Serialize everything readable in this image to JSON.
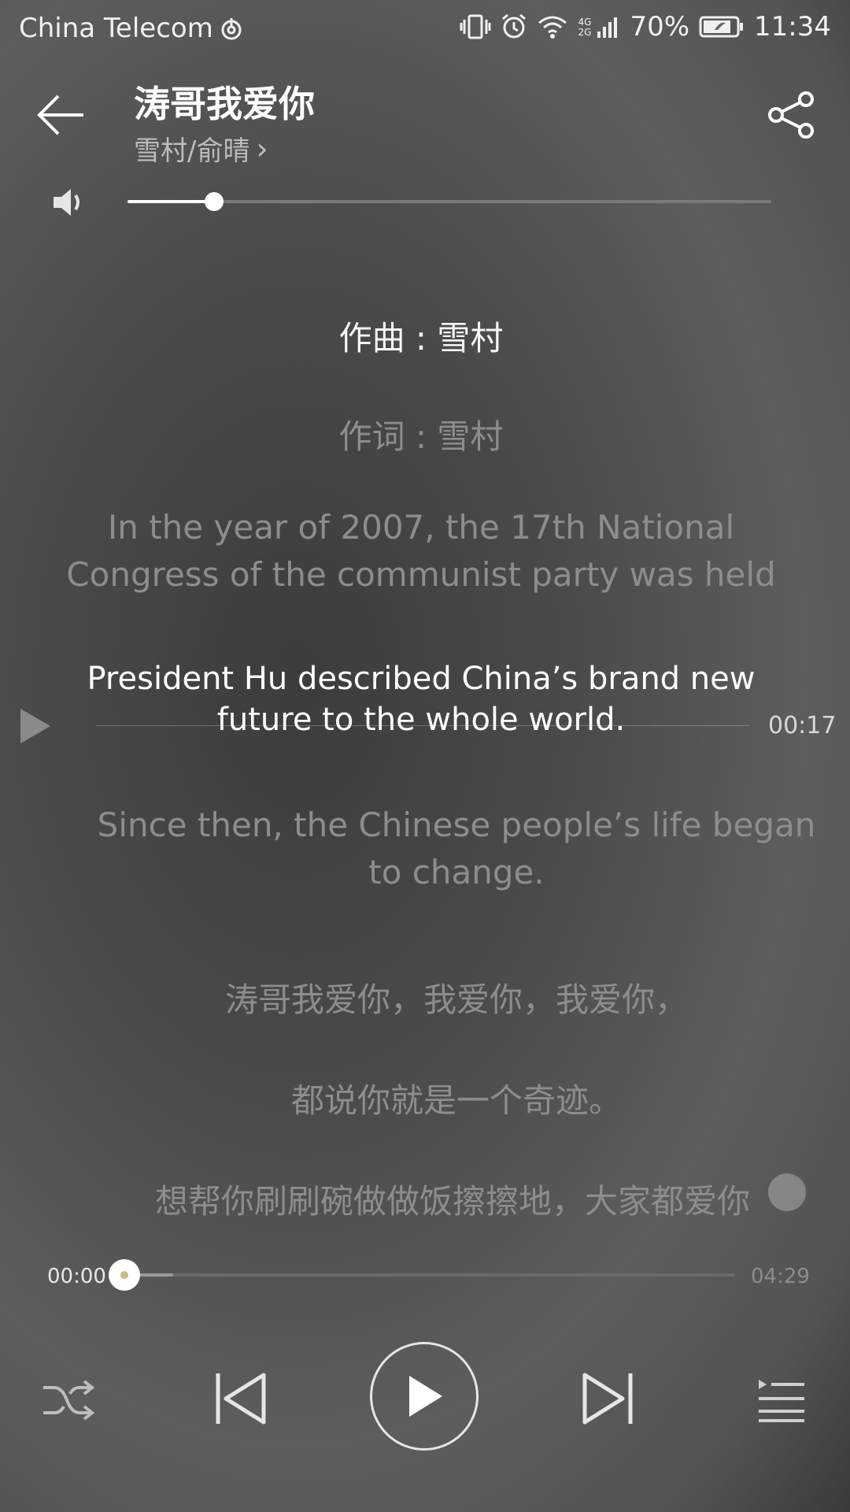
{
  "status_bar": {
    "carrier": "China Telecom",
    "network": "4G 2G",
    "battery": "70%",
    "time": "11:34"
  },
  "header": {
    "title": "涛哥我爱你",
    "artist": "雪村/俞晴",
    "artist_chevron": "›"
  },
  "volume": {
    "level": 0.135
  },
  "lyrics": [
    {
      "lines": [
        "作曲 : 雪村"
      ],
      "style": "bright"
    },
    {
      "lines": [
        "作词 : 雪村"
      ],
      "style": "dim"
    },
    {
      "lines": [
        "In the year of 2007, the 17th National",
        "Congress of the communist party was held"
      ],
      "style": "dim"
    },
    {
      "lines": [
        "President Hu described China’s brand new",
        "future to the whole world."
      ],
      "style": "active"
    },
    {
      "lines": [
        "Since then, the Chinese people’s life began",
        "to change."
      ],
      "style": "dim"
    },
    {
      "lines": [
        "涛哥我爱你，我爱你，我爱你，"
      ],
      "style": "dim"
    },
    {
      "lines": [
        "都说你就是一个奇迹。"
      ],
      "style": "dim"
    },
    {
      "lines": [
        "想帮你刷刷碗做做饭擦擦地，大家都爱你"
      ],
      "style": "dim"
    }
  ],
  "scrub": {
    "time": "00:17"
  },
  "progress": {
    "current": "00:00",
    "total": "04:29",
    "played": 0.0,
    "buffered": 0.08
  },
  "controls": {
    "shuffle": "shuffle-icon",
    "previous": "previous-icon",
    "play": "play-icon",
    "next": "next-icon",
    "playlist": "playlist-icon"
  }
}
